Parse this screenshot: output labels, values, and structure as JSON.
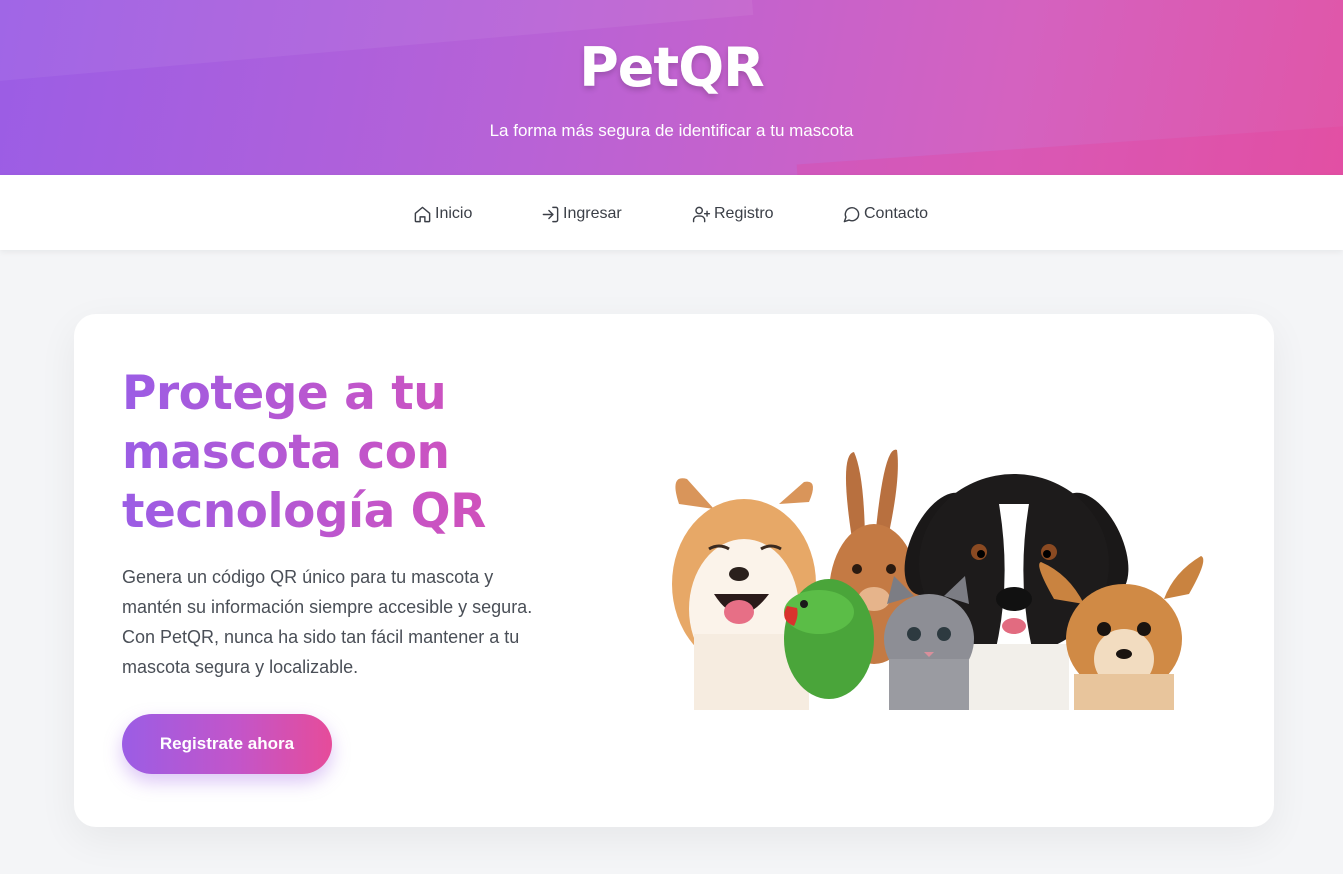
{
  "header": {
    "brand": "PetQR",
    "tagline": "La forma más segura de identificar a tu mascota"
  },
  "nav": {
    "items": [
      {
        "label": "Inicio",
        "icon": "home-icon"
      },
      {
        "label": "Ingresar",
        "icon": "login-icon"
      },
      {
        "label": "Registro",
        "icon": "user-plus-icon"
      },
      {
        "label": "Contacto",
        "icon": "message-icon"
      }
    ]
  },
  "hero": {
    "title": "Protege a tu mascota con tecnología QR",
    "description": "Genera un código QR único para tu mascota y mantén su información siempre accesible y segura. Con PetQR, nunca ha sido tan fácil mantener a tu mascota segura y localizable.",
    "cta_label": "Registrate ahora",
    "image": "pets-group-illustration"
  },
  "colors": {
    "brand_purple": "#9b5de5",
    "brand_pink": "#e056a8",
    "text_dark": "#3b3f47",
    "page_bg": "#f4f5f7"
  }
}
